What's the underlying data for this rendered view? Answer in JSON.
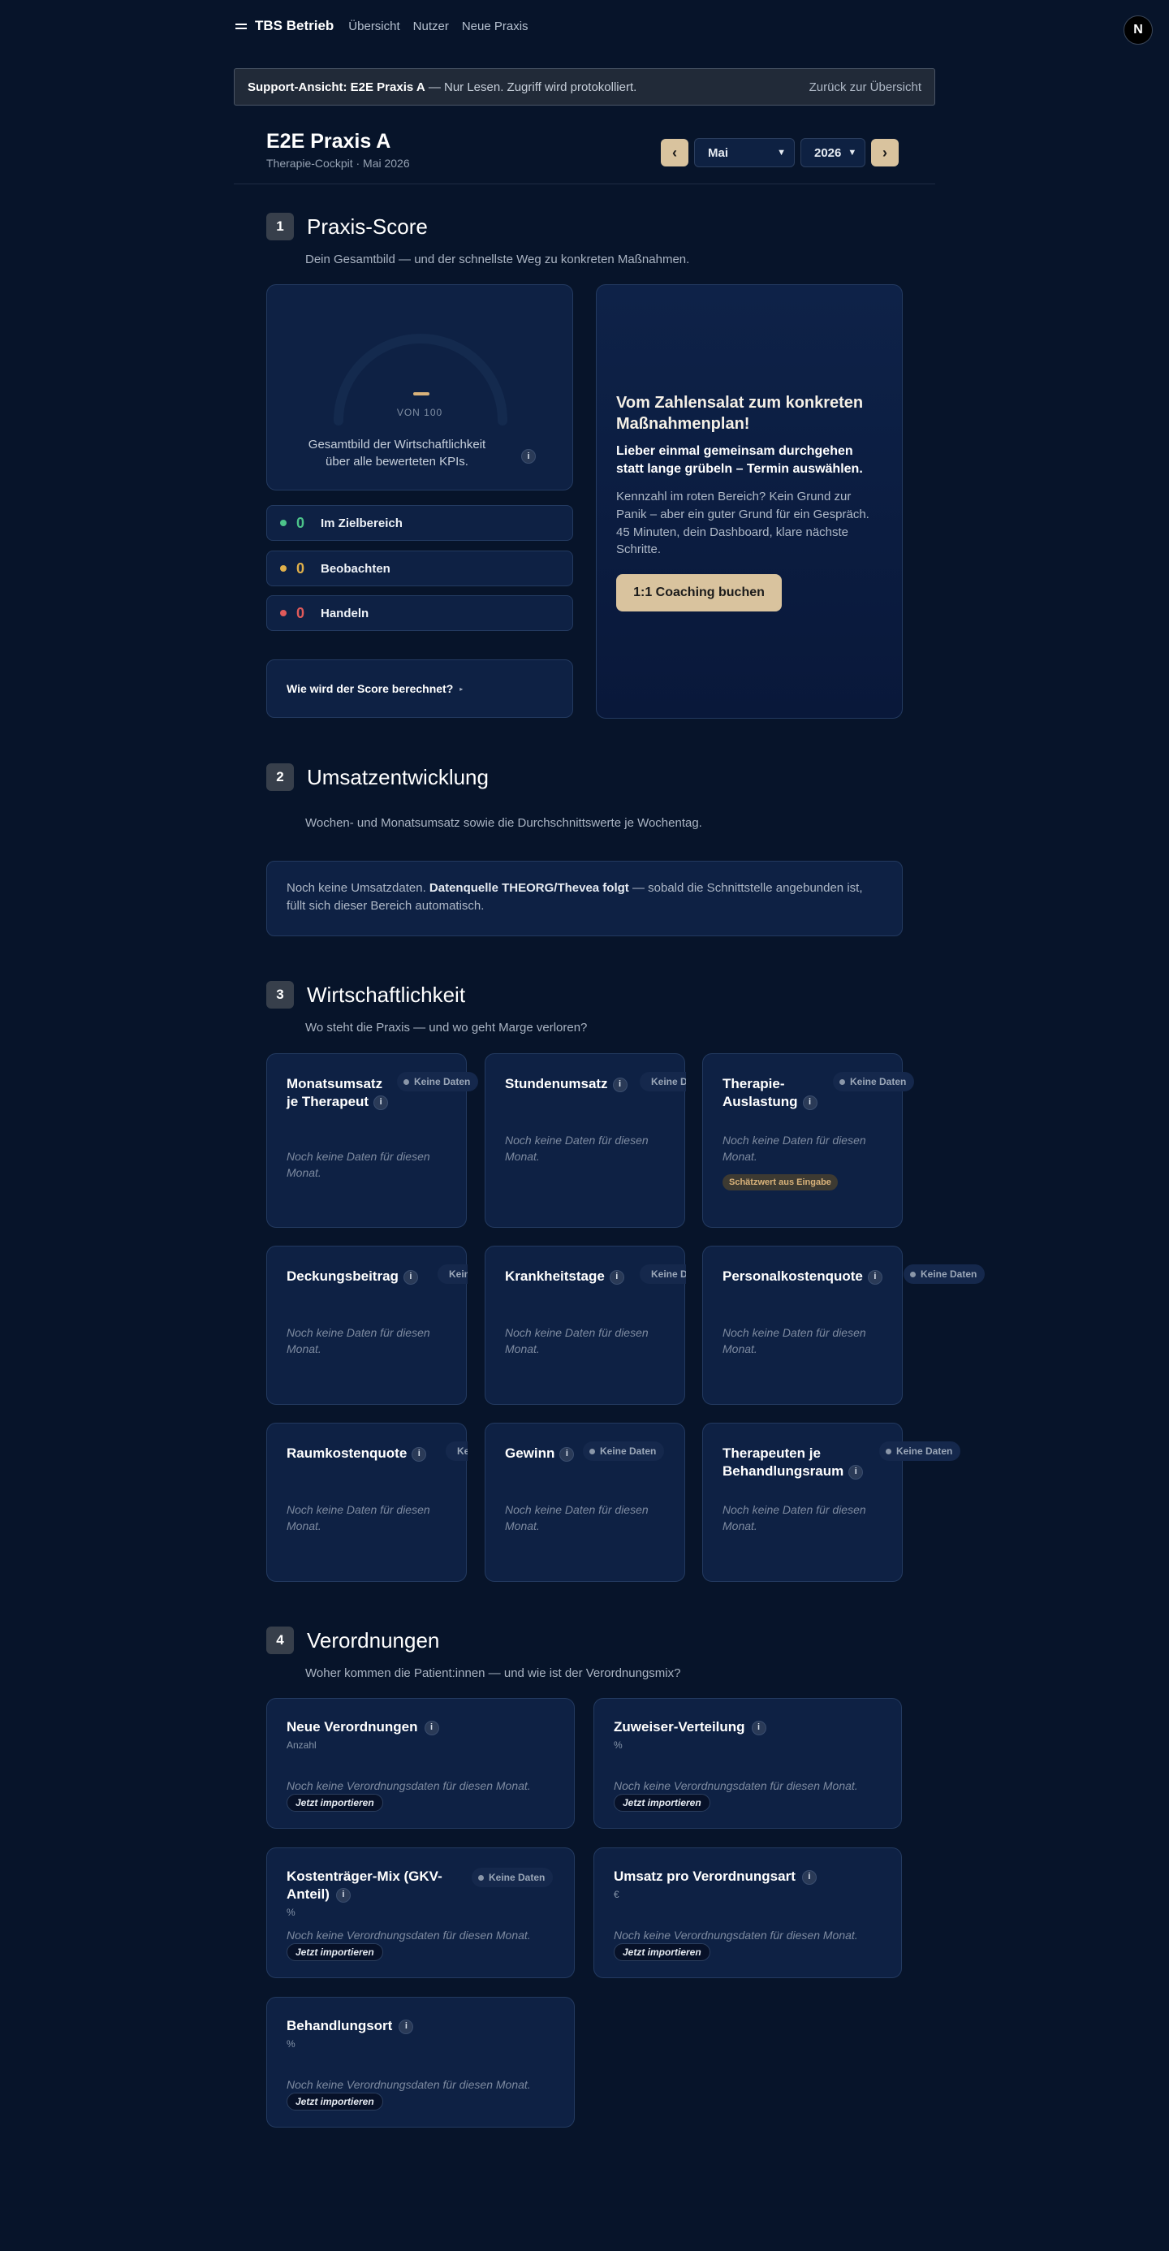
{
  "nav": {
    "brand": "TBS Betrieb",
    "links": [
      "Übersicht",
      "Nutzer",
      "Neue Praxis"
    ],
    "avatar_letter": "N"
  },
  "banner": {
    "strong": "Support-Ansicht: E2E Praxis A",
    "text": " — Nur Lesen. Zugriff wird protokolliert.",
    "back": "Zurück zur Übersicht"
  },
  "header": {
    "title": "E2E Praxis A",
    "subtitle": "Therapie-Cockpit · Mai 2026",
    "prev": "‹",
    "next": "›",
    "month": "Mai",
    "year": "2026"
  },
  "score": {
    "num": "1",
    "title": "Praxis-Score",
    "desc": "Dein Gesamtbild — und der schnellste Weg zu konkreten Maßnahmen.",
    "of_label": "VON 100",
    "gauge_text": "Gesamtbild der Wirtschaftlichkeit über alle bewerteten KPIs.",
    "info": "i",
    "statuses": [
      {
        "count": "0",
        "label": "Im Zielbereich",
        "color": "#4cc38a"
      },
      {
        "count": "0",
        "label": "Beobachten",
        "color": "#e0b04a"
      },
      {
        "count": "0",
        "label": "Handeln",
        "color": "#e05a5a"
      }
    ],
    "how": "Wie wird der Score berechnet?",
    "how_arrow": "▸"
  },
  "coaching": {
    "heading": "Vom Zahlensalat zum konkreten Maßnahmenplan!",
    "sub": "Lieber einmal gemeinsam durchgehen statt lange grübeln – Termin auswählen.",
    "text": "Kennzahl im roten Bereich? Kein Grund zur Panik – aber ein guter Grund für ein Gespräch. 45 Minuten, dein Dashboard, klare nächste Schritte.",
    "button": "1:1 Coaching buchen"
  },
  "umsatz": {
    "num": "2",
    "title": "Umsatzentwicklung",
    "desc": "Wochen- und Monatsumsatz sowie die Durchschnittswerte je Wochentag.",
    "note_prefix": "Noch keine Umsatzdaten. ",
    "note_strong": "Datenquelle THEORG/Thevea folgt",
    "note_suffix": " — sobald die Schnittstelle angebunden ist, füllt sich dieser Bereich automatisch."
  },
  "wirtschaft": {
    "num": "3",
    "title": "Wirtschaftlichkeit",
    "desc": "Wo steht die Praxis — und wo geht Marge verloren?",
    "no_data_badge": "Keine Daten",
    "no_data_badge_short": "Keine D",
    "no_data_badge_tiny": "Keine",
    "empty": "Noch keine Daten für diesen Monat.",
    "estimate": "Schätzwert aus Eingabe",
    "cards": [
      {
        "title": "Monatsumsatz je Therapeut"
      },
      {
        "title": "Stundenumsatz"
      },
      {
        "title": "Therapie-Auslastung"
      },
      {
        "title": "Deckungsbeitrag"
      },
      {
        "title": "Krankheitstage"
      },
      {
        "title": "Personalkostenquote"
      },
      {
        "title": "Raumkostenquote"
      },
      {
        "title": "Gewinn"
      },
      {
        "title": "Therapeuten je Behandlungsraum"
      }
    ]
  },
  "verordnungen": {
    "num": "4",
    "title": "Verordnungen",
    "desc": "Woher kommen die Patient:innen — und wie ist der Verordnungsmix?",
    "empty": "Noch keine Verordnungsdaten für diesen Monat.",
    "import": "Jetzt importieren",
    "badge": "Keine Daten",
    "cards": [
      {
        "title": "Neue Verordnungen",
        "unit": "Anzahl"
      },
      {
        "title": "Zuweiser-Verteilung",
        "unit": "%"
      },
      {
        "title": "Kostenträger-Mix (GKV-Anteil)",
        "unit": "%"
      },
      {
        "title": "Umsatz pro Verordnungsart",
        "unit": "€"
      },
      {
        "title": "Behandlungsort",
        "unit": "%"
      }
    ]
  }
}
